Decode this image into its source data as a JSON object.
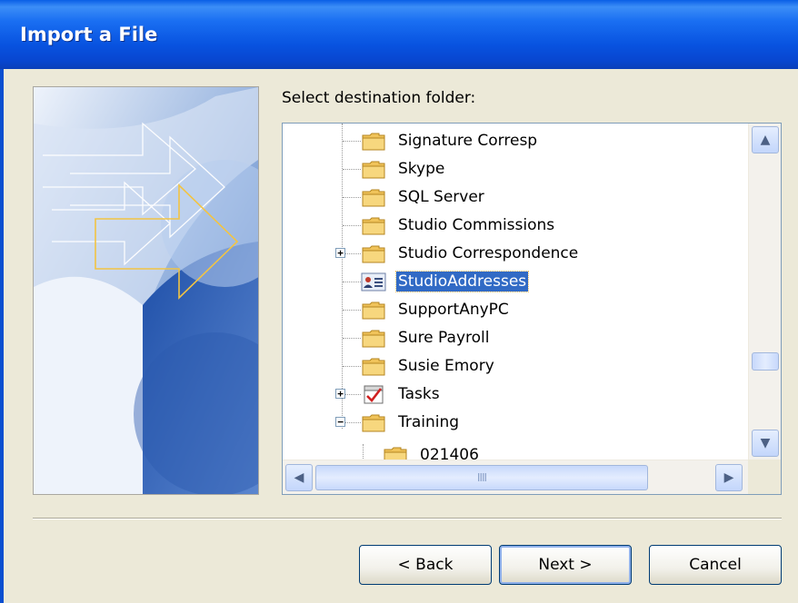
{
  "window": {
    "title": "Import a File"
  },
  "dest_label": "Select destination folder:",
  "tree": {
    "items": [
      {
        "label": "Signature Corresp",
        "icon": "folder-icon",
        "expander": ""
      },
      {
        "label": "Skype",
        "icon": "folder-icon",
        "expander": ""
      },
      {
        "label": "SQL Server",
        "icon": "folder-icon",
        "expander": ""
      },
      {
        "label": "Studio Commissions",
        "icon": "folder-icon",
        "expander": ""
      },
      {
        "label": "Studio Correspondence",
        "icon": "folder-icon",
        "expander": "+"
      },
      {
        "label": "StudioAddresses",
        "icon": "contacts-folder-icon",
        "expander": "",
        "selected": true
      },
      {
        "label": "SupportAnyPC",
        "icon": "folder-icon",
        "expander": ""
      },
      {
        "label": "Sure Payroll",
        "icon": "folder-icon",
        "expander": ""
      },
      {
        "label": "Susie Emory",
        "icon": "folder-icon",
        "expander": ""
      },
      {
        "label": "Tasks",
        "icon": "tasks-icon",
        "expander": "+"
      },
      {
        "label": "Training",
        "icon": "folder-icon",
        "expander": "−"
      },
      {
        "label": "021406",
        "icon": "folder-icon",
        "expander": "",
        "child": true
      }
    ]
  },
  "scrollbar": {
    "h_grip": "IIII"
  },
  "buttons": {
    "back": "< Back",
    "next": "Next >",
    "cancel": "Cancel"
  }
}
